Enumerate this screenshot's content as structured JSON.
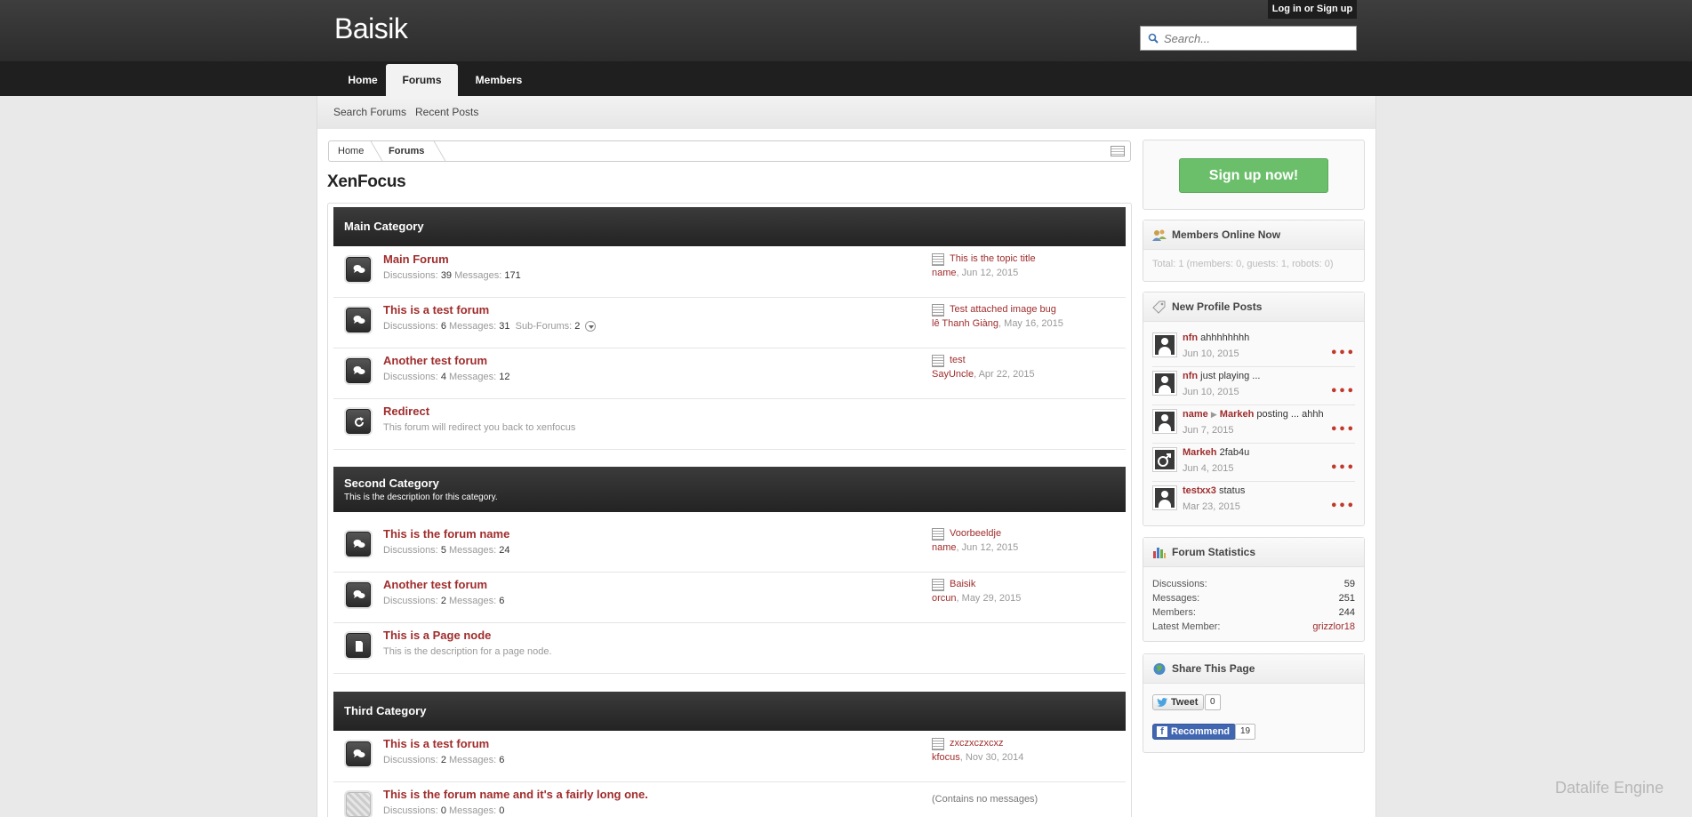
{
  "header": {
    "logo": "Baisik",
    "login_label": "Log in or Sign up",
    "search_placeholder": "Search..."
  },
  "nav": {
    "tabs": [
      {
        "label": "Home",
        "active": false
      },
      {
        "label": "Forums",
        "active": true
      },
      {
        "label": "Members",
        "active": false
      }
    ],
    "subnav": [
      "Search Forums",
      "Recent Posts"
    ]
  },
  "breadcrumb": [
    "Home",
    "Forums"
  ],
  "page_title": "XenFocus",
  "categories": [
    {
      "title": "Main Category",
      "description": "",
      "forums": [
        {
          "name": "Main Forum",
          "icon": "chat-bubbles-icon",
          "discussions_label": "Discussions:",
          "discussions": "39",
          "messages_label": "Messages:",
          "messages": "171",
          "last_title": "This is the topic title",
          "last_user": "name",
          "last_date": "Jun 12, 2015"
        },
        {
          "name": "This is a test forum",
          "icon": "chat-bubbles-icon",
          "discussions_label": "Discussions:",
          "discussions": "6",
          "messages_label": "Messages:",
          "messages": "31",
          "subforums_label": "Sub-Forums:",
          "subforums": "2",
          "last_title": "Test attached image bug",
          "last_user": "lê Thanh Giàng",
          "last_date": "May 16, 2015"
        },
        {
          "name": "Another test forum",
          "icon": "chat-bubbles-icon",
          "discussions_label": "Discussions:",
          "discussions": "4",
          "messages_label": "Messages:",
          "messages": "12",
          "last_title": "test",
          "last_user": "SayUncle",
          "last_date": "Apr 22, 2015"
        },
        {
          "name": "Redirect",
          "icon": "redirect-icon",
          "description": "This forum will redirect you back to xenfocus"
        }
      ]
    },
    {
      "title": "Second Category",
      "description": "This is the description for this category.",
      "forums": [
        {
          "name": "This is the forum name",
          "icon": "chat-bubbles-icon",
          "discussions_label": "Discussions:",
          "discussions": "5",
          "messages_label": "Messages:",
          "messages": "24",
          "last_title": "Voorbeeldje",
          "last_user": "name",
          "last_date": "Jun 12, 2015"
        },
        {
          "name": "Another test forum",
          "icon": "chat-bubbles-icon",
          "discussions_label": "Discussions:",
          "discussions": "2",
          "messages_label": "Messages:",
          "messages": "6",
          "last_title": "Baisik",
          "last_user": "orcun",
          "last_date": "May 29, 2015"
        },
        {
          "name": "This is a Page node",
          "icon": "page-icon",
          "description": "This is the description for a page node."
        }
      ]
    },
    {
      "title": "Third Category",
      "description": "",
      "forums": [
        {
          "name": "This is a test forum",
          "icon": "chat-bubbles-icon",
          "discussions_label": "Discussions:",
          "discussions": "2",
          "messages_label": "Messages:",
          "messages": "6",
          "last_title": "zxczxczxcxz",
          "last_user": "kfocus",
          "last_date": "Nov 30, 2014"
        },
        {
          "name": "This is the forum name and it's a fairly long one.",
          "icon": "chat-bubbles-faded-icon",
          "discussions_label": "Discussions:",
          "discussions": "0",
          "messages_label": "Messages:",
          "messages": "0",
          "no_messages": "(Contains no messages)"
        }
      ]
    }
  ],
  "sidebar": {
    "signup_label": "Sign up now!",
    "members_online": {
      "title": "Members Online Now",
      "text": "Total: 1 (members: 0, guests: 1, robots: 0)"
    },
    "profile_posts": {
      "title": "New Profile Posts",
      "posts": [
        {
          "user": "nfn",
          "target": "",
          "text": "ahhhhhhhh",
          "date": "Jun 10, 2015",
          "avatar": "avatar-icon"
        },
        {
          "user": "nfn",
          "target": "",
          "text": "just playing ...",
          "date": "Jun 10, 2015",
          "avatar": "avatar-icon"
        },
        {
          "user": "name",
          "target": "Markeh",
          "text": "posting ... ahhh",
          "date": "Jun 7, 2015",
          "avatar": "avatar-icon"
        },
        {
          "user": "Markeh",
          "target": "",
          "text": "2fab4u",
          "date": "Jun 4, 2015",
          "avatar": "male-symbol-icon"
        },
        {
          "user": "testxx3",
          "target": "",
          "text": "status",
          "date": "Mar 23, 2015",
          "avatar": "avatar-icon"
        }
      ]
    },
    "statistics": {
      "title": "Forum Statistics",
      "rows": [
        {
          "label": "Discussions:",
          "value": "59"
        },
        {
          "label": "Messages:",
          "value": "251"
        },
        {
          "label": "Members:",
          "value": "244"
        },
        {
          "label": "Latest Member:",
          "value": "grizzlor18"
        }
      ]
    },
    "share": {
      "title": "Share This Page",
      "tweet_label": "Tweet",
      "tweet_count": "0",
      "recommend_label": "Recommend",
      "recommend_count": "19"
    }
  },
  "watermark": "Datalife Engine",
  "colors": {
    "accent_link": "#a02d2d",
    "header_bg": "#2c2c2c",
    "signup_green": "#6bbf6b"
  }
}
